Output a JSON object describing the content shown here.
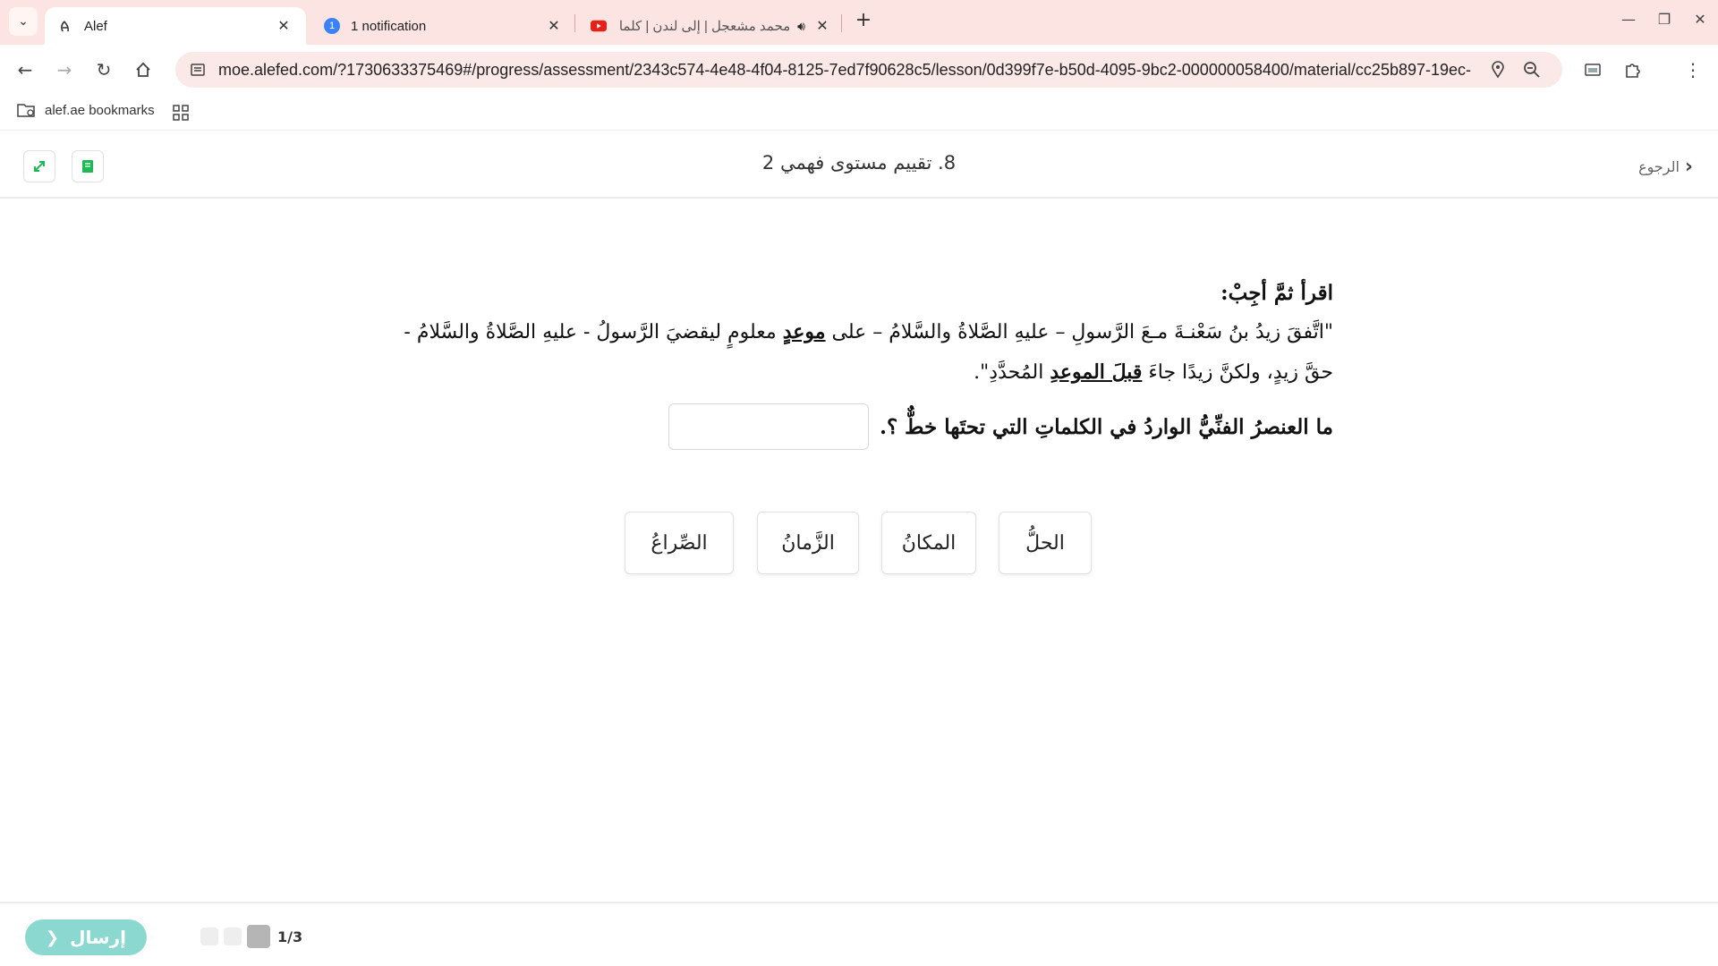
{
  "browser": {
    "tabs": [
      {
        "title": "Alef",
        "icon": "alef-logo-icon",
        "active": true
      },
      {
        "title": "1 notification",
        "icon": "notification-badge-icon",
        "badge": "1",
        "active": false
      },
      {
        "title": "محمد مشعجل | إلى لندن | كلما",
        "icon": "youtube-icon",
        "active": false
      }
    ],
    "url": "moe.alefed.com/?1730633375469#/progress/assessment/2343c574-4e48-4f04-8125-7ed7f90628c5/lesson/0d399f7e-b50d-4095-9bc2-000000058400/material/cc25b897-19ec-4...",
    "bookmark_folder": "alef.ae bookmarks",
    "accent": "#fbe4e1"
  },
  "header": {
    "title": "8. تقييم مستوى فهمي 2",
    "back_label": "الرجوع"
  },
  "question": {
    "heading": "اقرأ ثمَّ أجِبْ:",
    "passage": {
      "p1": "\"اتَّفقَ زيدُ بنُ سَعْنـةَ مـعَ الرَّسولِ – عليهِ الصَّلاةُ والسَّلامُ – على ",
      "u1": "موعدٍ",
      "p2": " معلومٍ ليقضيَ الرَّسولُ - عليهِ الصَّلاةُ والسَّلامُ - حقَّ زيدٍ، ولكنَّ زيدًا جاءَ ",
      "u2": "قبلَ الموعدِ",
      "p3": " المُحدَّدِ\"."
    },
    "prompt": "ما العنصرُ الفنِّيُّ الواردُ في الكلماتِ التي تحتَها خطٌّ ؟."
  },
  "options": [
    "الحلُّ",
    "المكانُ",
    "الزَّمانُ",
    "الصِّراعُ"
  ],
  "footer": {
    "submit_label": "إرسال",
    "page_indicator": "1/3",
    "submit_color": "#8ad8d0"
  }
}
